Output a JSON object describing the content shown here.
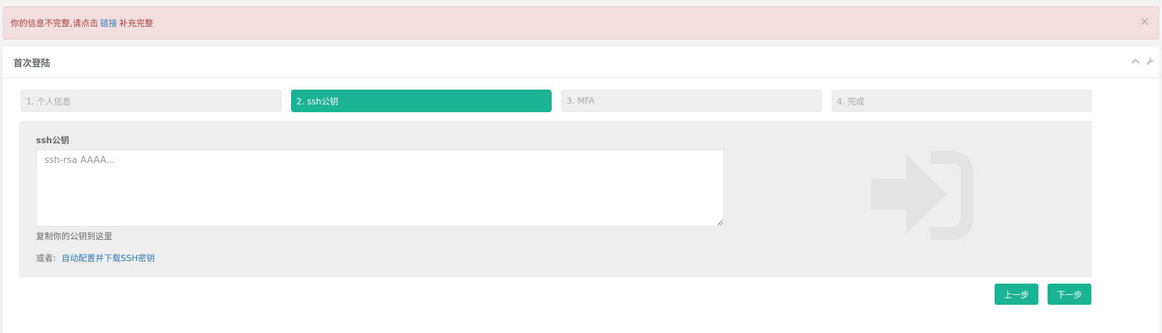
{
  "alert": {
    "text_before": "你的信息不完整,请点击",
    "link_text": "链接",
    "text_after": "补充完整",
    "close_glyph": "×"
  },
  "panel": {
    "title": "首次登陆"
  },
  "steps": [
    {
      "label": "1. 个人信息",
      "active": false
    },
    {
      "label": "2. ssh公钥",
      "active": true
    },
    {
      "label": "3. MFA",
      "active": false
    },
    {
      "label": "4. 完成",
      "active": false
    }
  ],
  "form": {
    "label": "ssh公钥",
    "placeholder": "ssh-rsa AAAA...",
    "value": "",
    "help": "复制你的公钥到这里",
    "or_label": "或者:",
    "auto_link": "自动配置并下载SSH密钥"
  },
  "buttons": {
    "prev": "上一步",
    "next": "下一步"
  },
  "colors": {
    "primary": "#1ab394",
    "alert_bg": "#f2dede",
    "alert_text": "#a94442",
    "link": "#337ab7"
  },
  "icons": {
    "close": "close-icon",
    "collapse": "chevron-up-icon",
    "settings": "wrench-icon",
    "background": "sign-in-icon"
  }
}
